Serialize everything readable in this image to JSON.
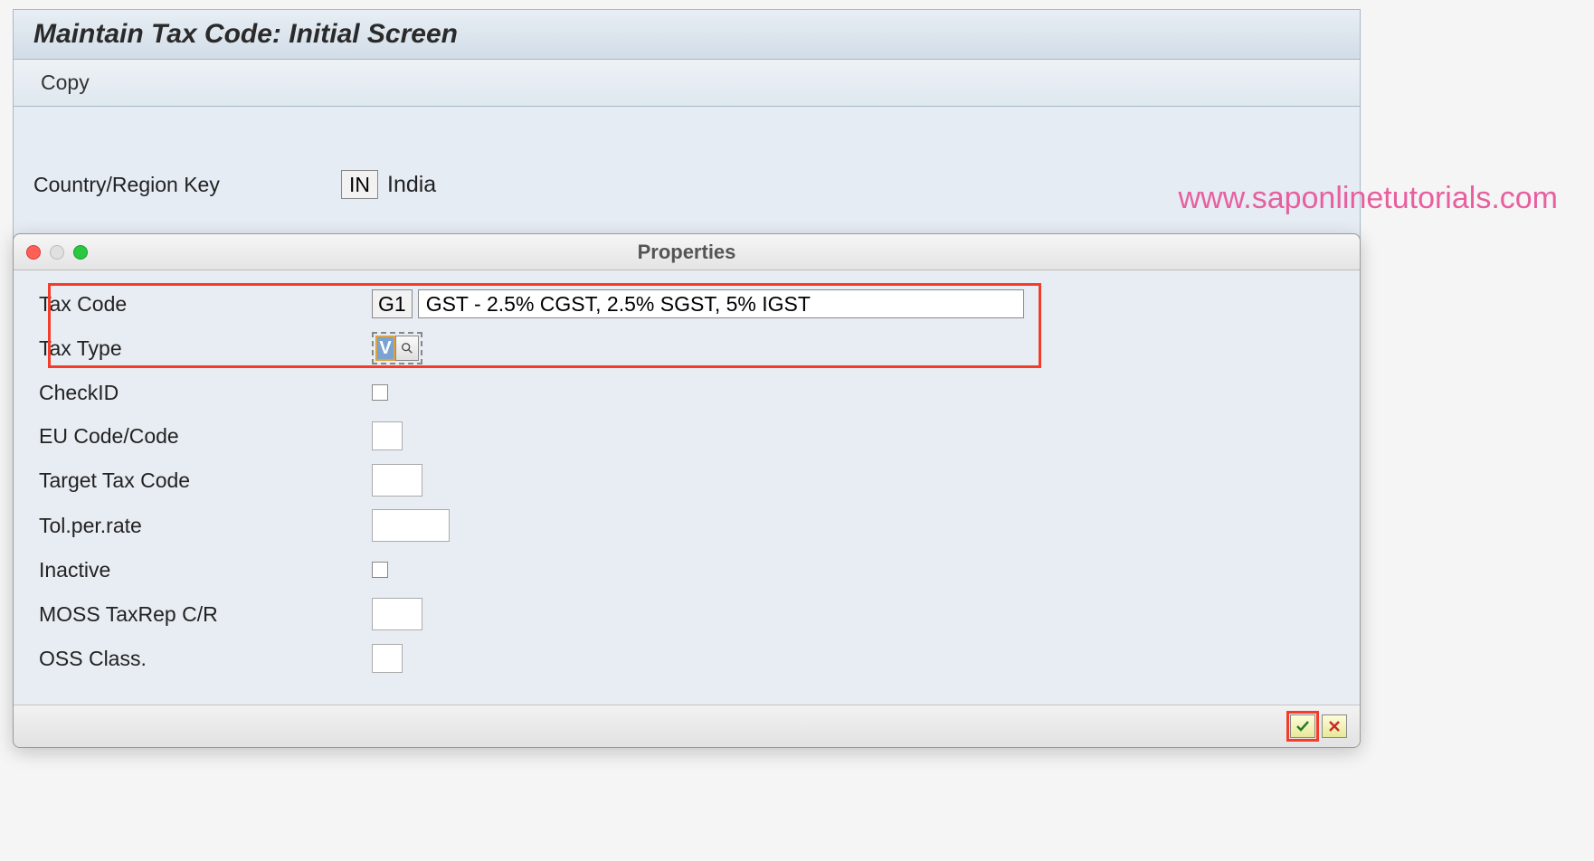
{
  "header": {
    "title": "Maintain Tax Code: Initial Screen"
  },
  "toolbar": {
    "copy_label": "Copy"
  },
  "main": {
    "country_label": "Country/Region Key",
    "country_code": "IN",
    "country_name": "India"
  },
  "watermark": "www.saponlinetutorials.com",
  "dialog": {
    "title": "Properties",
    "fields": {
      "tax_code": {
        "label": "Tax Code",
        "code": "G1",
        "description": "GST - 2.5% CGST, 2.5% SGST, 5% IGST"
      },
      "tax_type": {
        "label": "Tax Type",
        "value": "V"
      },
      "check_id": {
        "label": "CheckID"
      },
      "eu_code": {
        "label": "EU Code/Code",
        "value": ""
      },
      "target_tax": {
        "label": "Target Tax Code",
        "value": ""
      },
      "tol_rate": {
        "label": "Tol.per.rate",
        "value": ""
      },
      "inactive": {
        "label": "Inactive"
      },
      "moss": {
        "label": "MOSS TaxRep C/R",
        "value": ""
      },
      "oss": {
        "label": "OSS Class.",
        "value": ""
      }
    }
  }
}
